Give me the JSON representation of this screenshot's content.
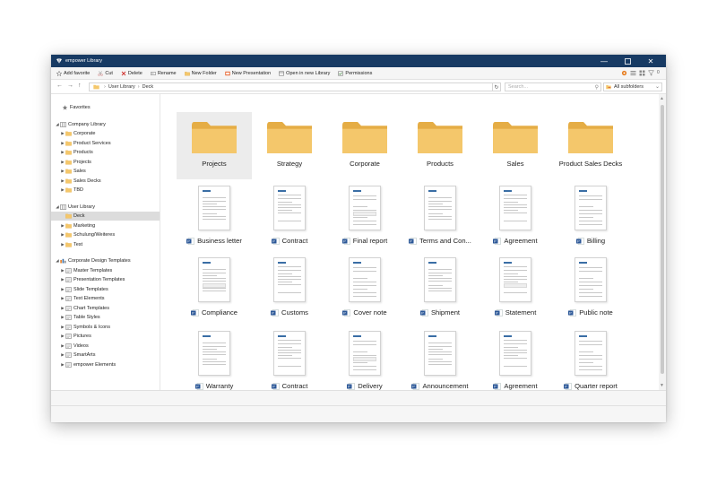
{
  "window": {
    "title": "empower Library",
    "colors": {
      "titlebar": "#173a63",
      "folder": "#f4c76b",
      "folder_dark": "#e5ad45",
      "ppt_blue": "#2b5797"
    }
  },
  "window_controls": {
    "minimize_icon": "minimize-icon",
    "maximize_icon": "maximize-icon",
    "close_icon": "close-icon"
  },
  "toolbar": {
    "items": [
      {
        "label": "Add favorite",
        "icon": "star-icon"
      },
      {
        "label": "Cut",
        "icon": "scissors-icon"
      },
      {
        "label": "Delete",
        "icon": "delete-x-icon"
      },
      {
        "label": "Rename",
        "icon": "rename-icon"
      },
      {
        "label": "New Folder",
        "icon": "new-folder-icon"
      },
      {
        "label": "New Presentation",
        "icon": "new-presentation-icon"
      },
      {
        "label": "Open in new Library",
        "icon": "open-library-icon"
      },
      {
        "label": "Permissions",
        "icon": "permissions-icon"
      }
    ],
    "right_icons": [
      "settings-icon",
      "list-view-icon",
      "tile-view-icon",
      "filter-icon"
    ],
    "right_badge": "0"
  },
  "navbar": {
    "breadcrumb": [
      "User Library",
      "Deck"
    ],
    "search_placeholder": "Search...",
    "subfolder_filter": "All subfolders"
  },
  "sidebar": {
    "favorites": "Favorites",
    "company_library": {
      "label": "Company Library",
      "children": [
        "Corporate",
        "Product Services",
        "Products",
        "Projects",
        "Sales",
        "Sales Decks",
        "TBD"
      ]
    },
    "user_library": {
      "label": "User Library",
      "children": [
        "Deck",
        "Marketing",
        "Schulung/Weiteres",
        "Test"
      ],
      "selected": "Deck"
    },
    "design_templates": {
      "label": "Corporate Design Templates",
      "children": [
        "Master Templates",
        "Presentation Templates",
        "Slide Templates",
        "Text Elements",
        "Chart Templates",
        "Table Styles",
        "Symbols & Icons",
        "Pictures",
        "Videos",
        "SmartArts",
        "empower Elements"
      ]
    }
  },
  "content": {
    "folders": [
      "Projects",
      "Strategy",
      "Corporate",
      "Products",
      "Sales",
      "Product Sales Decks"
    ],
    "selected_folder": "Projects",
    "documents": [
      "Business letter",
      "Contract",
      "Final report",
      "Terms and Con...",
      "Agreement",
      "Billing",
      "Compliance",
      "Customs",
      "Cover note",
      "Shipment",
      "Statement",
      "Public note",
      "Warranty",
      "Contract",
      "Delivery",
      "Announcement",
      "Agreement",
      "Quarter report"
    ]
  }
}
